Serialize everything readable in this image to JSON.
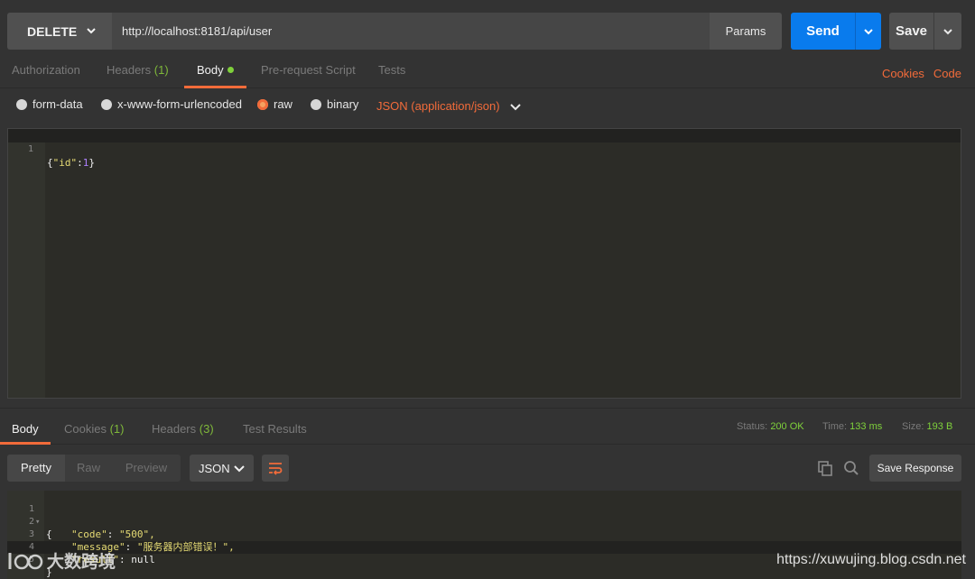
{
  "request": {
    "method": "DELETE",
    "url": "http://localhost:8181/api/user",
    "params_label": "Params",
    "send_label": "Send",
    "save_label": "Save"
  },
  "request_tabs": {
    "authorization": "Authorization",
    "headers": "Headers",
    "headers_count": "(1)",
    "body": "Body",
    "prerequest": "Pre-request Script",
    "tests": "Tests",
    "cookies": "Cookies",
    "code": "Code"
  },
  "body_types": {
    "form_data": "form-data",
    "urlencoded": "x-www-form-urlencoded",
    "raw": "raw",
    "binary": "binary",
    "selected": "raw",
    "content_type": "JSON (application/json)"
  },
  "request_body": {
    "line_number": "1",
    "open": "{",
    "key": "\"id\"",
    "colon": ":",
    "value": "1",
    "close": "}"
  },
  "response_tabs": {
    "body": "Body",
    "cookies": "Cookies",
    "cookies_count": "(1)",
    "headers": "Headers",
    "headers_count": "(3)",
    "test_results": "Test Results",
    "status_label": "Status:",
    "status_value": "200 OK",
    "time_label": "Time:",
    "time_value": "133 ms",
    "size_label": "Size:",
    "size_value": "193 B"
  },
  "response_toolbar": {
    "pretty": "Pretty",
    "raw": "Raw",
    "preview": "Preview",
    "format": "JSON",
    "save_response": "Save Response"
  },
  "response_body": {
    "lines": [
      {
        "n": "1",
        "text": "{"
      },
      {
        "n": "2",
        "key": "\"code\"",
        "value": "\"500\","
      },
      {
        "n": "3",
        "key": "\"message\"",
        "value": "\"服务器内部错误！\","
      },
      {
        "n": "4",
        "key": "\"result\"",
        "value": "null"
      },
      {
        "n": "5",
        "text": "}"
      }
    ]
  },
  "watermarks": {
    "left_text": "大数跨境",
    "right_text": "https://xuwujing.blog.csdn.net"
  },
  "colors": {
    "accent_orange": "#f26b3a",
    "send_blue": "#097bed",
    "ok_green": "#7fd13b"
  }
}
